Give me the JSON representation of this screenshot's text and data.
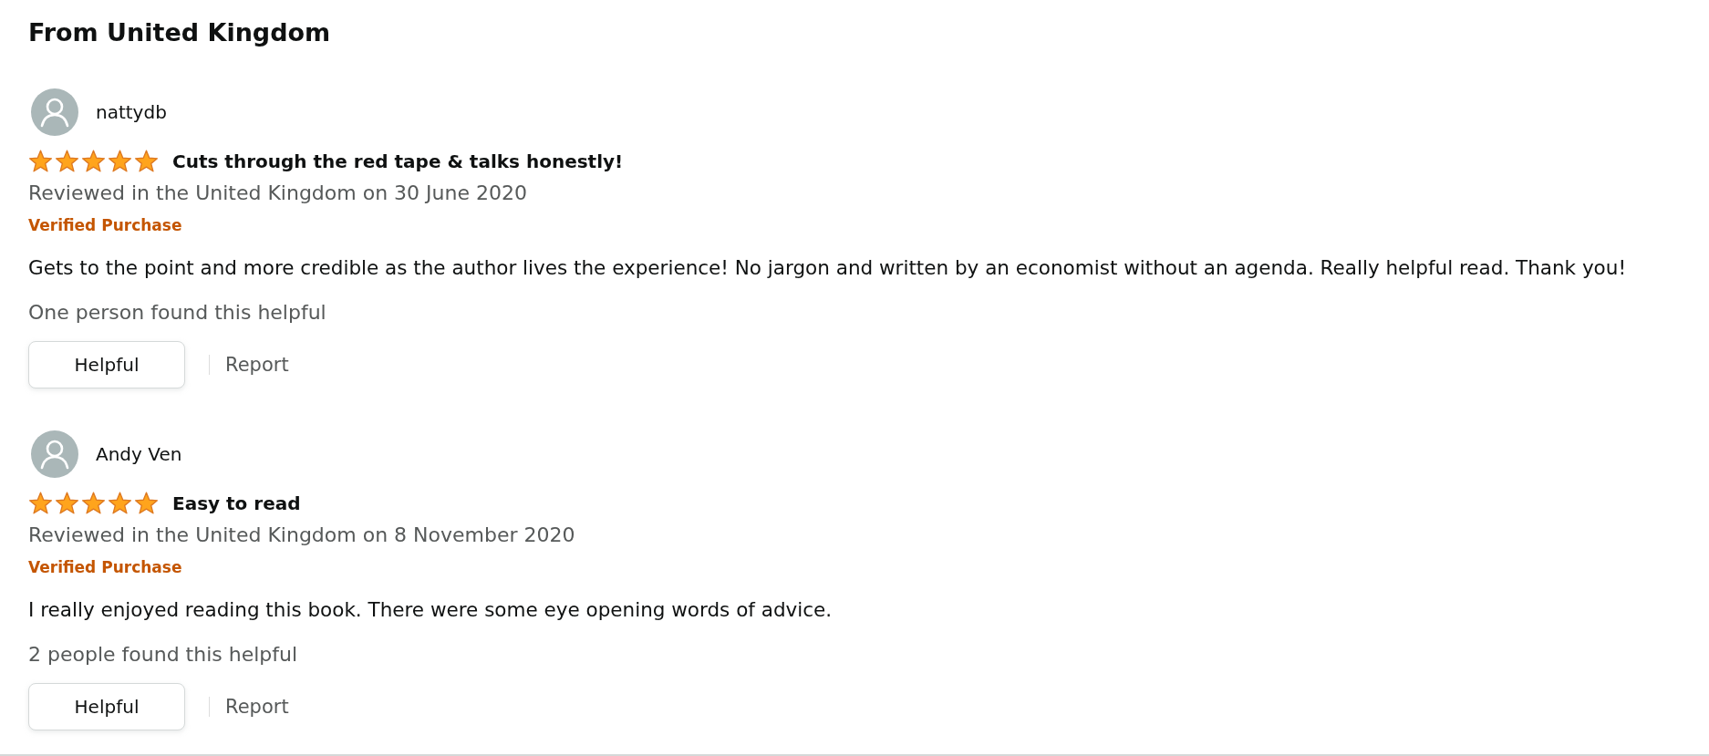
{
  "section": {
    "title": "From United Kingdom"
  },
  "reviews": [
    {
      "author": "nattydb",
      "stars": 5,
      "title": "Cuts through the red tape & talks honestly!",
      "meta": "Reviewed in the United Kingdom on 30 June 2020",
      "badge": "Verified Purchase",
      "body": "Gets to the point and more credible as the author lives the experience! No jargon and written by an economist without an agenda. Really helpful read. Thank you!",
      "helpful_count": "One person found this helpful",
      "actions": {
        "helpful": "Helpful",
        "report": "Report"
      }
    },
    {
      "author": "Andy Ven",
      "stars": 5,
      "title": "Easy to read",
      "meta": "Reviewed in the United Kingdom on 8 November 2020",
      "badge": "Verified Purchase",
      "body": "I really enjoyed reading this book. There were some eye opening words of advice.",
      "helpful_count": "2 people found this helpful",
      "actions": {
        "helpful": "Helpful",
        "report": "Report"
      }
    }
  ]
}
